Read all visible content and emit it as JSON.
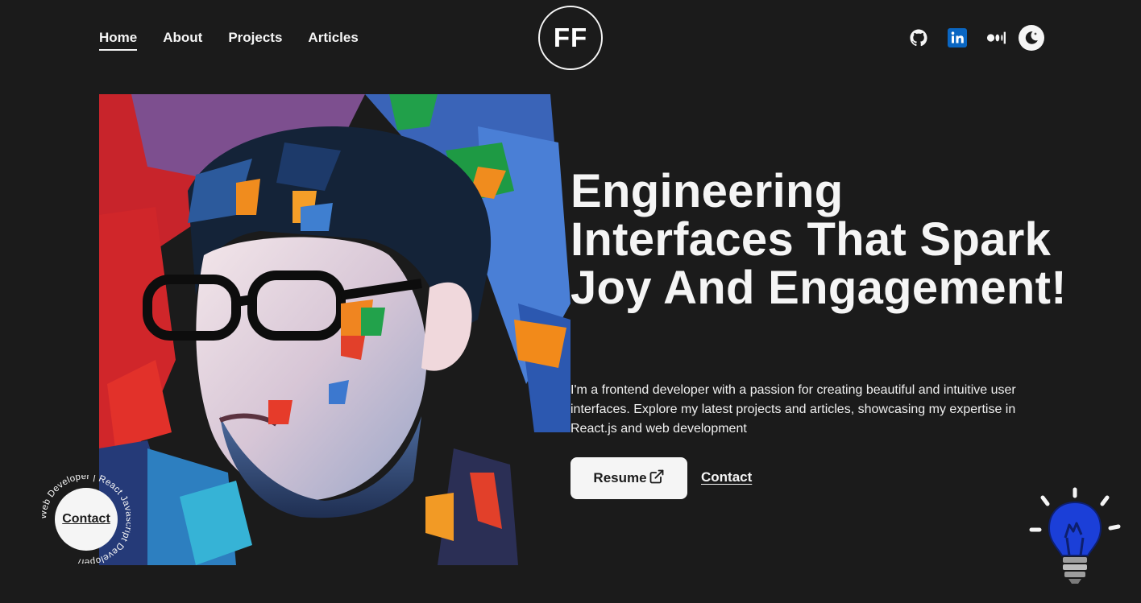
{
  "nav": {
    "items": [
      {
        "label": "Home",
        "active": true
      },
      {
        "label": "About"
      },
      {
        "label": "Projects"
      },
      {
        "label": "Articles"
      }
    ]
  },
  "logo": {
    "text": "FF"
  },
  "social": {
    "icons": [
      "github-icon",
      "linkedin-icon",
      "medium-icon",
      "moon-icon"
    ]
  },
  "hero": {
    "headline": "Engineering Interfaces That Spark Joy And Engagement!",
    "intro": "I'm a frontend developer with a passion for creating beautiful and intuitive user interfaces. Explore my latest projects and articles, showcasing my expertise in React.js and web development",
    "resume_label": "Resume",
    "contact_label": "Contact"
  },
  "badge": {
    "label": "Contact",
    "ring_text": "Web Developer | React Javascript Developer/ "
  },
  "colors": {
    "background": "#1b1b1b",
    "foreground": "#f5f5f5",
    "linkedin": "#0a66c2",
    "bulb": "#1b3fd8"
  }
}
